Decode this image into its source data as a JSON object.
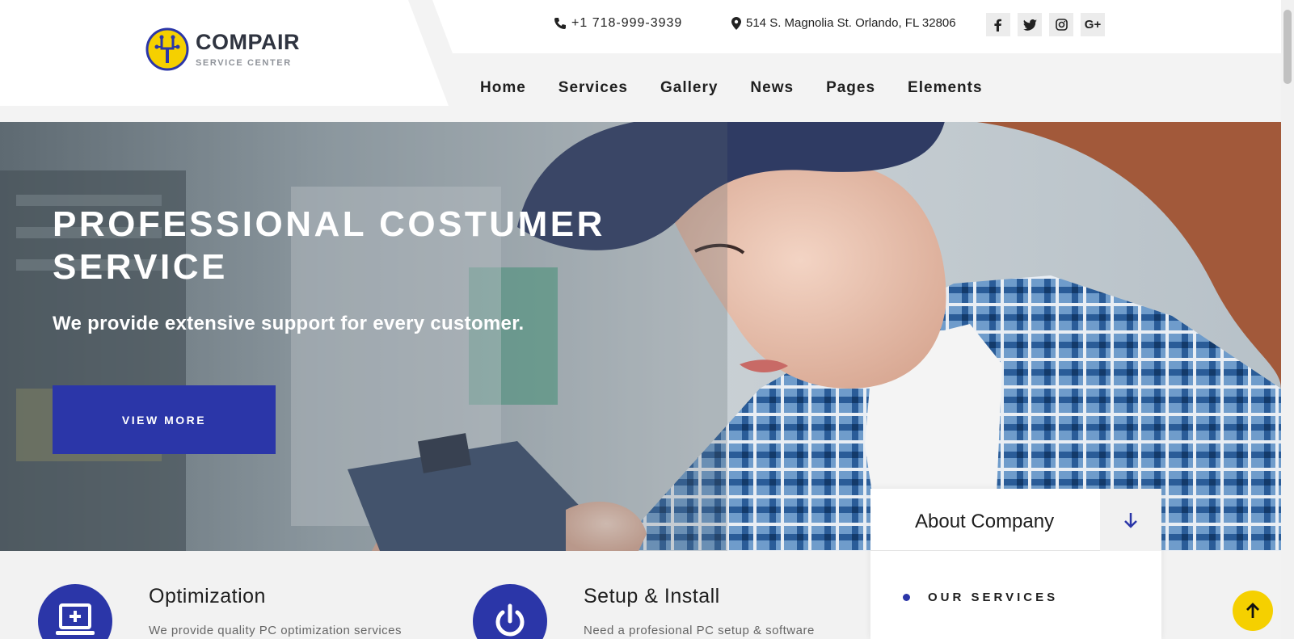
{
  "brand": {
    "name": "COMPAIR",
    "tagline": "SERVICE CENTER",
    "colors": {
      "accent": "#2b36a8",
      "yellow": "#f5d000"
    }
  },
  "contact": {
    "phone": "+1 718-999-3939",
    "address": "514 S. Magnolia St. Orlando, FL 32806"
  },
  "socials": [
    {
      "icon": "facebook-icon",
      "glyph": "f"
    },
    {
      "icon": "twitter-icon",
      "glyph": "t"
    },
    {
      "icon": "instagram-icon",
      "glyph": "o"
    },
    {
      "icon": "google-plus-icon",
      "glyph": "G+"
    }
  ],
  "nav": [
    "Home",
    "Services",
    "Gallery",
    "News",
    "Pages",
    "Elements"
  ],
  "hero": {
    "title": "PROFESSIONAL COSTUMER SERVICE",
    "subtitle": "We provide extensive support for every customer.",
    "button": "VIEW MORE"
  },
  "about": {
    "title": "About Company",
    "item": "OUR SERVICES"
  },
  "services": [
    {
      "title": "Optimization",
      "desc": "We provide quality PC optimization services",
      "icon": "monitor-icon"
    },
    {
      "title": "Setup & Install",
      "desc": "Need a profesional PC setup & software",
      "icon": "power-icon"
    }
  ]
}
